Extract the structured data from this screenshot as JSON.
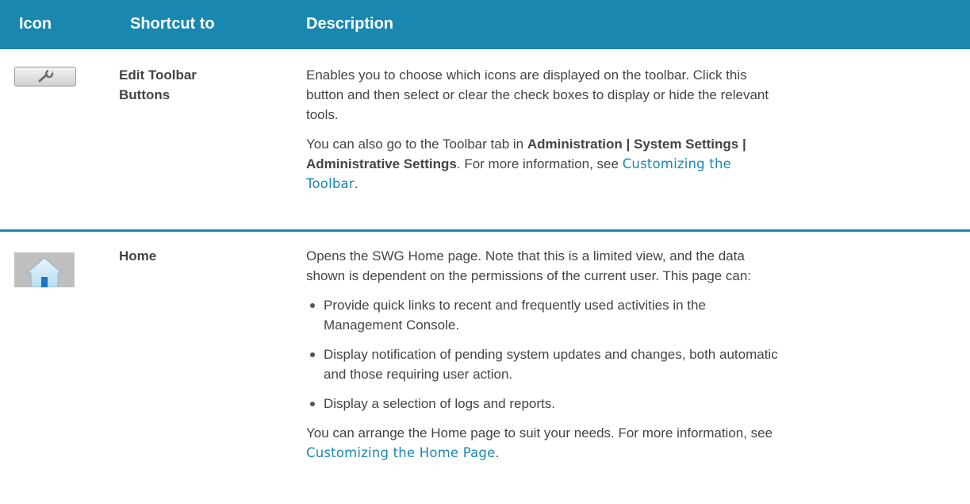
{
  "header": {
    "col_icon": "Icon",
    "col_shortcut": "Shortcut to",
    "col_description": "Description"
  },
  "rows": [
    {
      "icon": "wrench-icon",
      "shortcut_line1": "Edit Toolbar",
      "shortcut_line2": "Buttons",
      "desc_p1_line1": "Enables you to choose which icons are displayed on the toolbar. Click this",
      "desc_p1_line2": "button and then select or clear the check boxes to display or hide the relevant",
      "desc_p1_line3": "tools.",
      "desc_p2_pre": "You can also go to the Toolbar tab in ",
      "desc_p2_bold1": "Administration | System Settings |",
      "desc_p2_bold2": "Administrative Settings",
      "desc_p2_mid": ". For more information, see ",
      "desc_p2_link_part1": "Customizing the",
      "desc_p2_link_part2": "Toolbar",
      "desc_p2_end": "."
    },
    {
      "icon": "home-icon",
      "shortcut": "Home",
      "desc_p1_line1": "Opens the SWG Home page. Note that this is a limited view, and the data",
      "desc_p1_line2": "shown is dependent on the permissions of the current user. This page can:",
      "bullet1_line1": "Provide quick links to recent and frequently used activities in the",
      "bullet1_line2": "Management Console.",
      "bullet2_line1": "Display notification of pending system updates and changes, both automatic",
      "bullet2_line2": "and those requiring user action.",
      "bullet3": "Display a selection of logs and reports.",
      "desc_p2_line1": "You can arrange the Home page to suit your needs. For more information, see",
      "desc_p2_link": "Customizing the Home Page",
      "desc_p2_end": "."
    }
  ],
  "colors": {
    "header_bg": "#1a87b0",
    "link": "#1a87b0",
    "text": "#444444"
  }
}
